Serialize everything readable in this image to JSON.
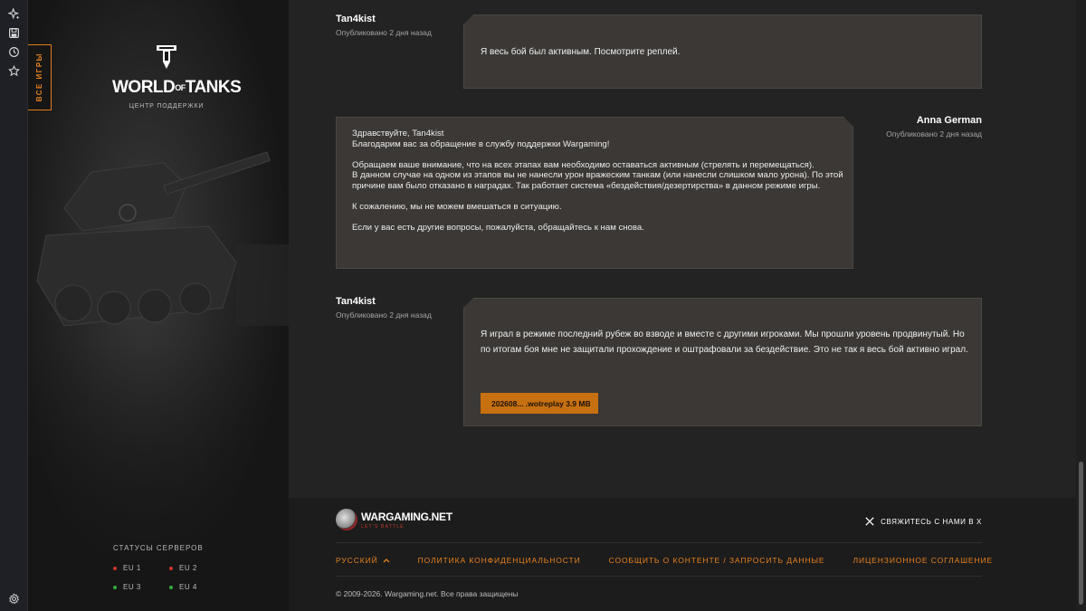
{
  "toolbar": {
    "icons": [
      "sparkle-icon",
      "save-icon",
      "history-icon",
      "star-icon",
      "settings-icon"
    ]
  },
  "sidebar": {
    "games_tab_label": "ВСЕ ИГРЫ",
    "logo": {
      "word_left": "WORLD",
      "word_mid": "OF",
      "word_right": "TANKS",
      "subtitle": "ЦЕНТР ПОДДЕРЖКИ"
    },
    "servers": {
      "title": "СТАТУСЫ СЕРВЕРОВ",
      "items": [
        {
          "name": "EU 1",
          "status_color": "#d0352a"
        },
        {
          "name": "EU 2",
          "status_color": "#d0352a"
        },
        {
          "name": "EU 3",
          "status_color": "#2fae3c"
        },
        {
          "name": "EU 4",
          "status_color": "#2fae3c"
        }
      ]
    }
  },
  "messages": [
    {
      "author": "Tan4kist",
      "published": "Опубликовано 2 дня назад",
      "text": "Я весь бой был активным. Посмотрите реплей."
    },
    {
      "author": "Anna German",
      "published": "Опубликовано 2 дня назад",
      "text": "Здравствуйте, Tan4kist\nБлагодарим вас за обращение в службу поддержки Wargaming!\n\nОбращаем ваше внимание, что на всех этапах вам необходимо оставаться активным (стрелять и перемещаться).\nВ данном случае на одном из этапов вы не нанесли урон вражеским танкам (или нанесли слишком мало урона). По этой причине вам было отказано в наградах. Так работает система «бездействия/дезертирства» в данном режиме игры.\n\nК сожалению, мы не можем вмешаться в ситуацию.\n\nЕсли у вас есть другие вопросы, пожалуйста, обращайтесь к нам снова."
    },
    {
      "author": "Tan4kist",
      "published": "Опубликовано 2 дня назад",
      "text": "Я играл в режиме последний рубеж во взводе и вместе с другими игроками. Мы прошли уровень продвинутый. Но по итогам боя мне не защитали прохождение и оштрафовали за бездействие. Это не так я весь бой активно играл.",
      "attachment": "202608... .wotreplay  3.9 MB"
    }
  ],
  "footer": {
    "brand_name": "WARGAMING.NET",
    "brand_tagline": "LET'S BATTLE",
    "contact_label": "СВЯЖИТЕСЬ С НАМИ В X",
    "language": "РУССКИЙ",
    "links": [
      "ПОЛИТИКА КОНФИДЕНЦИАЛЬНОСТИ",
      "СООБЩИТЬ О КОНТЕНТЕ / ЗАПРОСИТЬ ДАННЫЕ",
      "ЛИЦЕНЗИОННОЕ СОГЛАШЕНИЕ"
    ],
    "copyright": "© 2009-2026. Wargaming.net. Все права защищены"
  },
  "colors": {
    "accent": "#e8821f",
    "bubble": "#3b3835",
    "page": "#232323"
  }
}
